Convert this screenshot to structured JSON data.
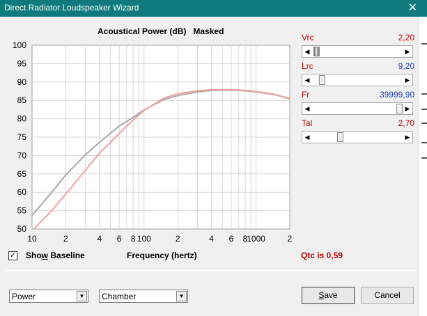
{
  "window": {
    "title": "Direct Radiator Loudspeaker Wizard"
  },
  "chart_header": {
    "left": "Acoustical Power (dB)",
    "right": "Masked"
  },
  "chart_data": {
    "type": "line",
    "title": "Acoustical Power (dB)",
    "xlabel": "Frequency (hertz)",
    "ylabel": "",
    "xscale": "log",
    "xlim": [
      10,
      2000
    ],
    "ylim": [
      50,
      100
    ],
    "grid": true,
    "y_ticks": [
      "100",
      "95",
      "90",
      "85",
      "80",
      "75",
      "70",
      "65",
      "60",
      "55",
      "50"
    ],
    "x_ticks": [
      {
        "value": 10,
        "label": "10"
      },
      {
        "value": 20,
        "label": "2"
      },
      {
        "value": 40,
        "label": "4"
      },
      {
        "value": 60,
        "label": "6"
      },
      {
        "value": 80,
        "label": "8"
      },
      {
        "value": 100,
        "label": "100"
      },
      {
        "value": 200,
        "label": "2"
      },
      {
        "value": 400,
        "label": "4"
      },
      {
        "value": 600,
        "label": "6"
      },
      {
        "value": 800,
        "label": "8"
      },
      {
        "value": 1000,
        "label": "1000"
      },
      {
        "value": 2000,
        "label": "2"
      }
    ],
    "series": [
      {
        "color": "#a8a8a8",
        "x": [
          10,
          15,
          20,
          30,
          40,
          60,
          80,
          100,
          150,
          200,
          300,
          400,
          600,
          800,
          1000,
          1500,
          2000
        ],
        "y": [
          53.7,
          60.0,
          64.7,
          70.2,
          73.6,
          78.0,
          80.4,
          82.4,
          85.2,
          86.3,
          87.3,
          87.7,
          87.8,
          87.6,
          87.3,
          86.5,
          85.4
        ]
      },
      {
        "color": "#f0a0a0",
        "x": [
          10,
          15,
          20,
          30,
          40,
          60,
          80,
          100,
          150,
          200,
          300,
          400,
          600,
          800,
          1000,
          1500,
          2000
        ],
        "y": [
          49.5,
          55.0,
          59.5,
          66.0,
          70.6,
          76.0,
          79.7,
          82.3,
          85.6,
          86.8,
          87.6,
          87.9,
          87.9,
          87.7,
          87.4,
          86.6,
          85.5
        ]
      }
    ]
  },
  "baseline": {
    "label": "Show Baseline",
    "checked": "✓"
  },
  "xaxis_caption": "Frequency (hertz)",
  "qtc_text": "Qtc is 0,59",
  "sliders": [
    {
      "name": "Vrc",
      "value": "2,20",
      "value_color": "red",
      "level": 0.02,
      "thumb": "hatched"
    },
    {
      "name": "Lrc",
      "value": "9,20",
      "value_color": "blue",
      "level": 0.08,
      "thumb": "plain"
    },
    {
      "name": "Fr",
      "value": "39999,90",
      "value_color": "blue",
      "level": 1.0,
      "thumb": "plain"
    },
    {
      "name": "Tal",
      "value": "2,70",
      "value_color": "red",
      "level": 0.3,
      "thumb": "plain"
    }
  ],
  "combos": [
    {
      "value": "Power"
    },
    {
      "value": "Chamber"
    }
  ],
  "buttons": {
    "save": "Save",
    "cancel": "Cancel"
  }
}
